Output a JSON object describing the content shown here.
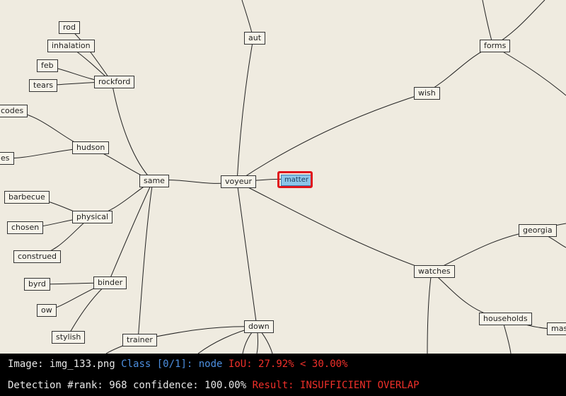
{
  "nodes": {
    "rod": "rod",
    "inhalation": "inhalation",
    "feb": "feb",
    "tears": "tears",
    "rockford": "rockford",
    "codes": "codes",
    "es": "es",
    "hudson": "hudson",
    "same": "same",
    "barbecue": "barbecue",
    "chosen": "chosen",
    "physical": "physical",
    "construed": "construed",
    "byrd": "byrd",
    "binder": "binder",
    "ow": "ow",
    "stylish": "stylish",
    "trainer": "trainer",
    "aut": "aut",
    "voyeur": "voyeur",
    "matter": "matter",
    "down": "down",
    "wish": "wish",
    "forms": "forms",
    "watches": "watches",
    "georgia": "georgia",
    "households": "households",
    "mas": "mas"
  },
  "highlight": {
    "node": "matter",
    "color": "#e0141b"
  },
  "status": {
    "image_label": "Image:",
    "image_name": "img_133.png",
    "class_text": "Class [0/1]: node",
    "iou_text": "IoU: 27.92% < 30.00%",
    "rank_text": "Detection #rank: 968 confidence: 100.00%",
    "result_text": "Result: INSUFFICIENT OVERLAP"
  }
}
